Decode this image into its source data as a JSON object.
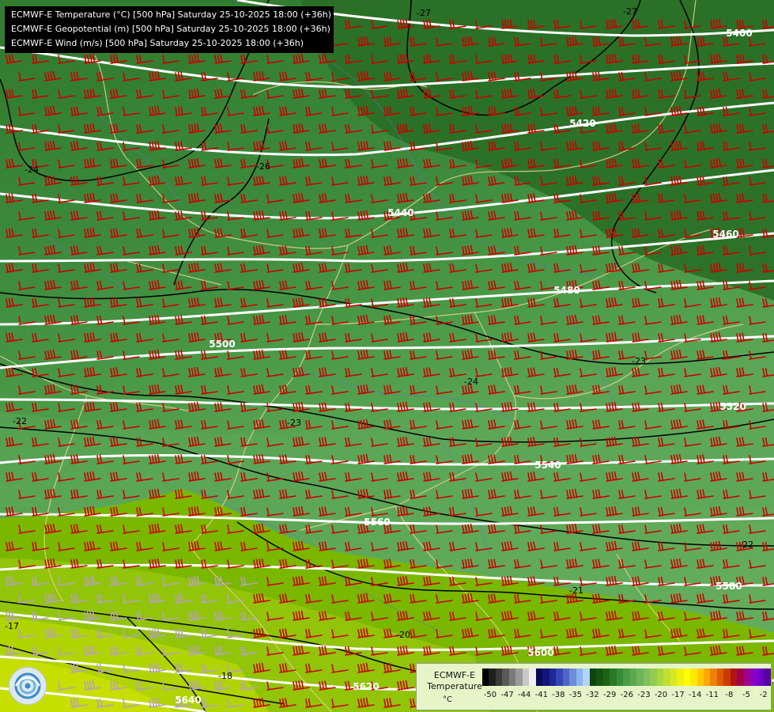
{
  "map": {
    "info_lines": [
      "ECMWF-E Temperature (°C) [500 hPa] Saturday 25-10-2025 18:00 (+36h)",
      "ECMWF-E Geopotential (m) [500 hPa] Saturday 25-10-2025 18:00 (+36h)",
      "ECMWF-E Wind (m/s) [500 hPa] Saturday 25-10-2025 18:00 (+36h)"
    ],
    "geopotential_labels": [
      "5400",
      "5420",
      "5440",
      "5460",
      "5480",
      "5500",
      "5520",
      "5540",
      "5560",
      "5580",
      "5600",
      "5620",
      "5640"
    ],
    "temperature_labels": [
      "-27",
      "-27",
      "-26",
      "-24",
      "-23",
      "-24",
      "-22",
      "-23",
      "-22",
      "-21",
      "-20",
      "-18",
      "-17"
    ],
    "colors": {
      "geopotential_line": "#ffffff",
      "temperature_line": "#000000",
      "wind_barb": "#cc0000",
      "wind_barb_light": "#b8a0c0",
      "border": "#e6d48c",
      "river": "#5a78c8"
    }
  },
  "legend": {
    "title": "ECMWF-E Temperature",
    "unit": "°C",
    "ticks": [
      "-50",
      "-47",
      "-44",
      "-41",
      "-38",
      "-35",
      "-32",
      "-29",
      "-26",
      "-23",
      "-20",
      "-17",
      "-14",
      "-11",
      "-8",
      "-5",
      "-2"
    ],
    "colors": [
      "#000000",
      "#1e1e1e",
      "#3a3a3a",
      "#5a5a5a",
      "#7a7a7a",
      "#9a9a9a",
      "#c8c8c8",
      "#f0f0f0",
      "#0a0a5a",
      "#14147a",
      "#1e2896",
      "#3246b4",
      "#5064c8",
      "#6e8cdc",
      "#8cb4f0",
      "#b4d2fa",
      "#0a460a",
      "#145514",
      "#1e6414",
      "#287828",
      "#378c37",
      "#4a9a46",
      "#5ca84e",
      "#6eb45a",
      "#80c060",
      "#92cc50",
      "#a8d840",
      "#c0e030",
      "#d8e820",
      "#f0f010",
      "#ffff00",
      "#ffe800",
      "#ffc800",
      "#ffa800",
      "#f08000",
      "#e05a00",
      "#c83c00",
      "#b41414",
      "#a0004a",
      "#a0008c",
      "#8c00c8",
      "#6e00c8",
      "#5a00a0"
    ]
  },
  "logo": {
    "name": "ecmwf-logo"
  }
}
